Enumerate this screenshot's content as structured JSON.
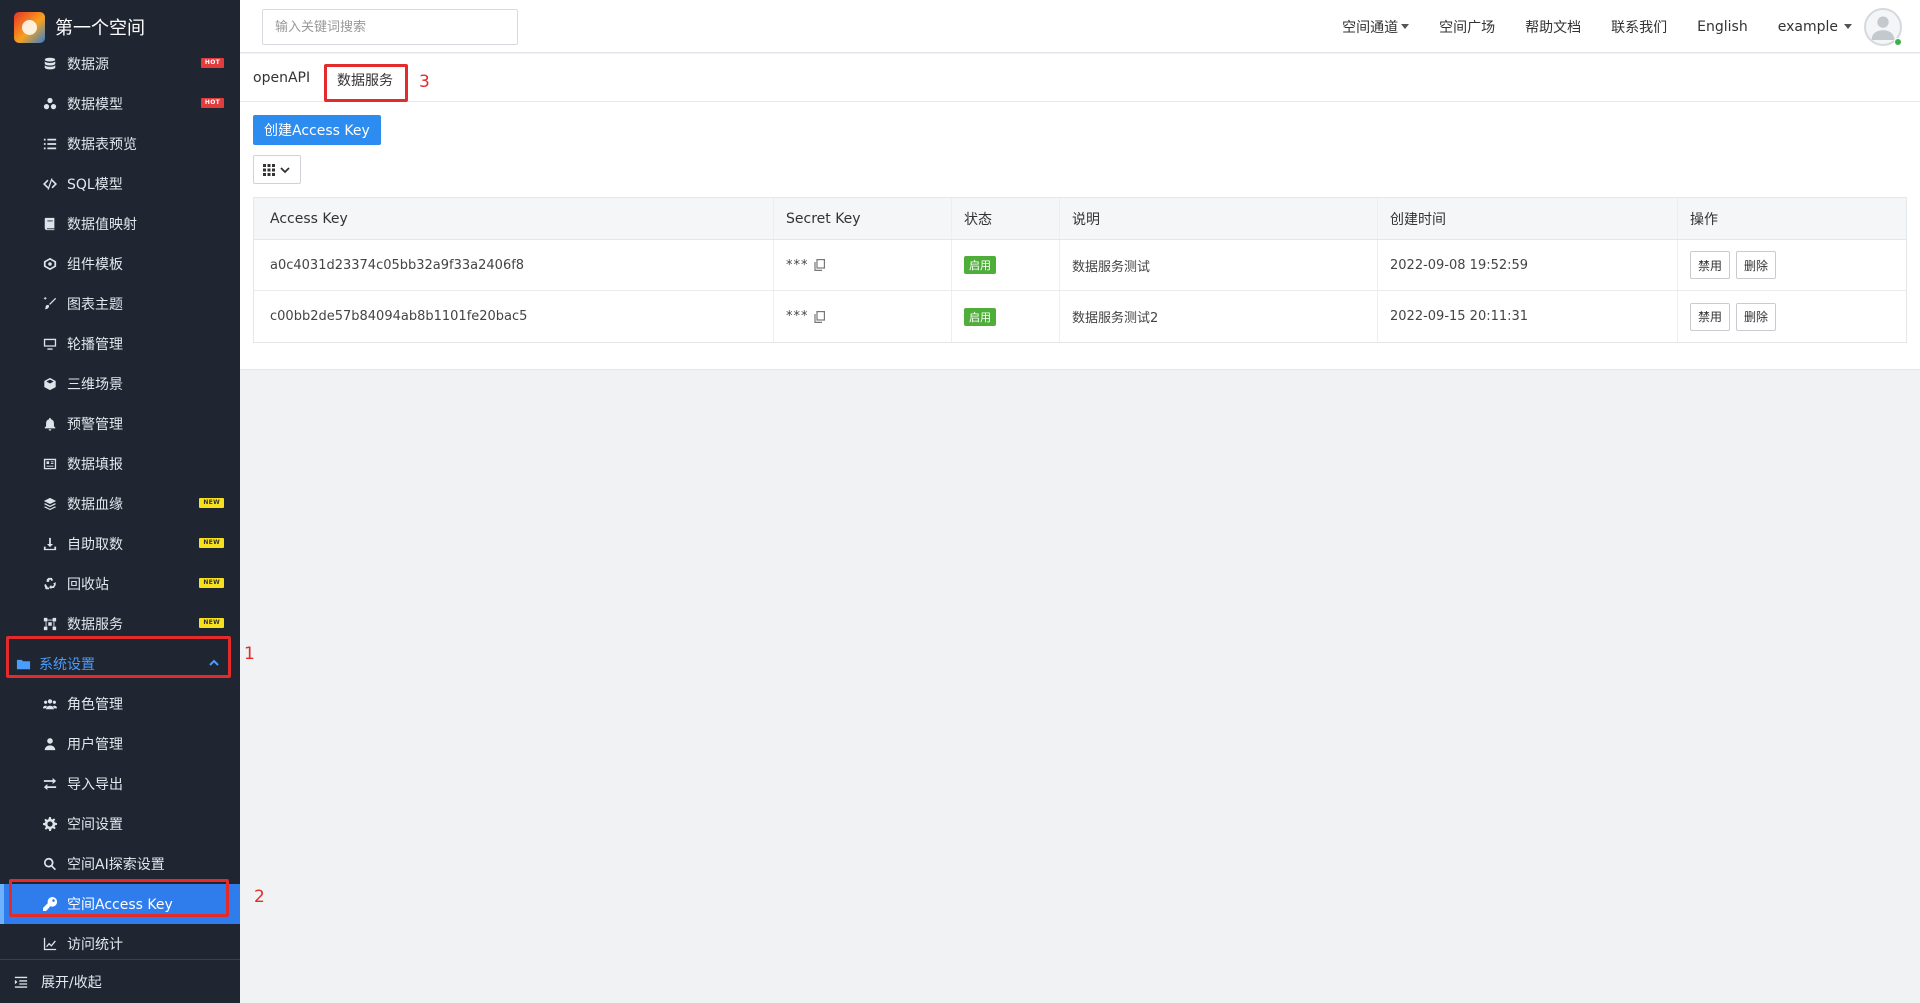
{
  "brand": {
    "title": "第一个空间"
  },
  "sidebar": {
    "items": [
      {
        "label": "数据源",
        "icon": "database-icon",
        "badge": "HOT"
      },
      {
        "label": "数据模型",
        "icon": "model-icon",
        "badge": "HOT"
      },
      {
        "label": "数据表预览",
        "icon": "list-icon",
        "badge": ""
      },
      {
        "label": "SQL模型",
        "icon": "code-icon",
        "badge": ""
      },
      {
        "label": "数据值映射",
        "icon": "book-icon",
        "badge": ""
      },
      {
        "label": "组件模板",
        "icon": "component-icon",
        "badge": ""
      },
      {
        "label": "图表主题",
        "icon": "brush-icon",
        "badge": ""
      },
      {
        "label": "轮播管理",
        "icon": "monitor-icon",
        "badge": ""
      },
      {
        "label": "三维场景",
        "icon": "cube-icon",
        "badge": ""
      },
      {
        "label": "预警管理",
        "icon": "bell-icon",
        "badge": ""
      },
      {
        "label": "数据填报",
        "icon": "form-icon",
        "badge": ""
      },
      {
        "label": "数据血缘",
        "icon": "layers-icon",
        "badge": "NEW"
      },
      {
        "label": "自助取数",
        "icon": "download-icon",
        "badge": "NEW"
      },
      {
        "label": "回收站",
        "icon": "recycle-icon",
        "badge": "NEW"
      },
      {
        "label": "数据服务",
        "icon": "network-icon",
        "badge": "NEW"
      }
    ],
    "group": {
      "label": "系统设置",
      "icon": "folder-icon"
    },
    "sub_items": [
      {
        "label": "角色管理",
        "icon": "users-icon"
      },
      {
        "label": "用户管理",
        "icon": "user-icon"
      },
      {
        "label": "导入导出",
        "icon": "exchange-icon"
      },
      {
        "label": "空间设置",
        "icon": "gear-icon"
      },
      {
        "label": "空间AI探索设置",
        "icon": "search-icon"
      },
      {
        "label": "空间Access Key",
        "icon": "key-icon",
        "active": true
      },
      {
        "label": "访问统计",
        "icon": "chart-line-icon"
      }
    ],
    "footer": {
      "label": "展开/收起"
    }
  },
  "annotations": {
    "n1": "1",
    "n2": "2",
    "n3": "3"
  },
  "header": {
    "search_placeholder": "输入关键词搜索",
    "links": [
      "空间通道",
      "空间广场",
      "帮助文档",
      "联系我们",
      "English"
    ],
    "user": "example"
  },
  "tabs": [
    "openAPI",
    "数据服务"
  ],
  "create_button": "创建Access Key",
  "table": {
    "columns": [
      "Access Key",
      "Secret Key",
      "状态",
      "说明",
      "创建时间",
      "操作"
    ],
    "rows": [
      {
        "access_key": "a0c4031d23374c05bb32a9f33a2406f8",
        "secret": "***",
        "status": "启用",
        "desc": "数据服务测试",
        "created": "2022-09-08 19:52:59",
        "actions": [
          "禁用",
          "删除"
        ]
      },
      {
        "access_key": "c00bb2de57b84094ab8b1101fe20bac5",
        "secret": "***",
        "status": "启用",
        "desc": "数据服务测试2",
        "created": "2022-09-15 20:11:31",
        "actions": [
          "禁用",
          "删除"
        ]
      }
    ]
  },
  "colors": {
    "accent": "#2d8cf0",
    "sidebar_bg": "#1f2631",
    "highlight": "#e42b2b",
    "status_green": "#4fae3a"
  }
}
